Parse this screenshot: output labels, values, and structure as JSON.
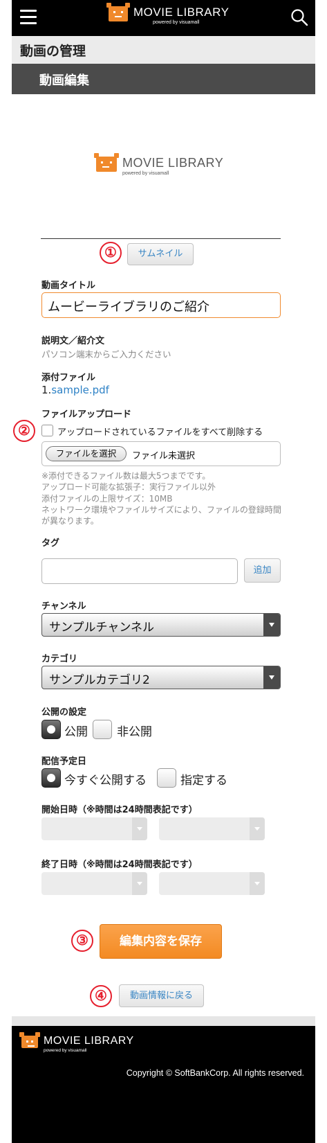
{
  "header": {
    "logo_title": "MOVIE LIBRARY",
    "logo_sub": "powered by visuamall"
  },
  "page_title": "動画の管理",
  "section_title": "動画編集",
  "thumbnail": {
    "logo_title": "MOVIE LIBRARY",
    "logo_sub": "powered by visuamall",
    "button_label": "サムネイル"
  },
  "markers": [
    "①",
    "②",
    "③",
    "④"
  ],
  "video_title": {
    "label": "動画タイトル",
    "value": "ムービーライブラリのご紹介"
  },
  "description": {
    "label": "説明文／紹介文",
    "text": "パソコン端末からご入力ください"
  },
  "attachment": {
    "label": "添付ファイル",
    "prefix": "1.",
    "file_name": "sample.pdf"
  },
  "upload": {
    "label": "ファイルアップロード",
    "delete_all_label": "アップロードされているファイルをすべて削除する",
    "choose_button": "ファイルを選択",
    "status": "ファイル未選択",
    "notes": [
      "※添付できるファイル数は最大5つまでです。",
      "アップロード可能な拡張子：実行ファイル以外",
      "添付ファイルの上限サイズ：10MB",
      "ネットワーク環境やファイルサイズにより、ファイルの登録時間が異なります。"
    ]
  },
  "tags": {
    "label": "タグ",
    "add_button": "追加"
  },
  "channel": {
    "label": "チャンネル",
    "selected": "サンプルチャンネル"
  },
  "category": {
    "label": "カテゴリ",
    "selected": "サンプルカテゴリ2"
  },
  "visibility": {
    "label": "公開の設定",
    "public": "公開",
    "private": "非公開",
    "selected": "public"
  },
  "schedule": {
    "label": "配信予定日",
    "now": "今すぐ公開する",
    "specify": "指定する",
    "selected": "now"
  },
  "start_date": {
    "label": "開始日時（※時間は24時間表記です）"
  },
  "end_date": {
    "label": "終了日時（※時間は24時間表記です）"
  },
  "save_button": "編集内容を保存",
  "back_button": "動画情報に戻る",
  "footer": {
    "logo_title": "MOVIE LIBRARY",
    "logo_sub": "powered by visuamall",
    "copyright": "Copyright © SoftBankCorp. All rights reserved."
  },
  "colors": {
    "accent_orange": "#f38a22",
    "link_blue": "#2e82c6",
    "marker_red": "#e6202e"
  }
}
